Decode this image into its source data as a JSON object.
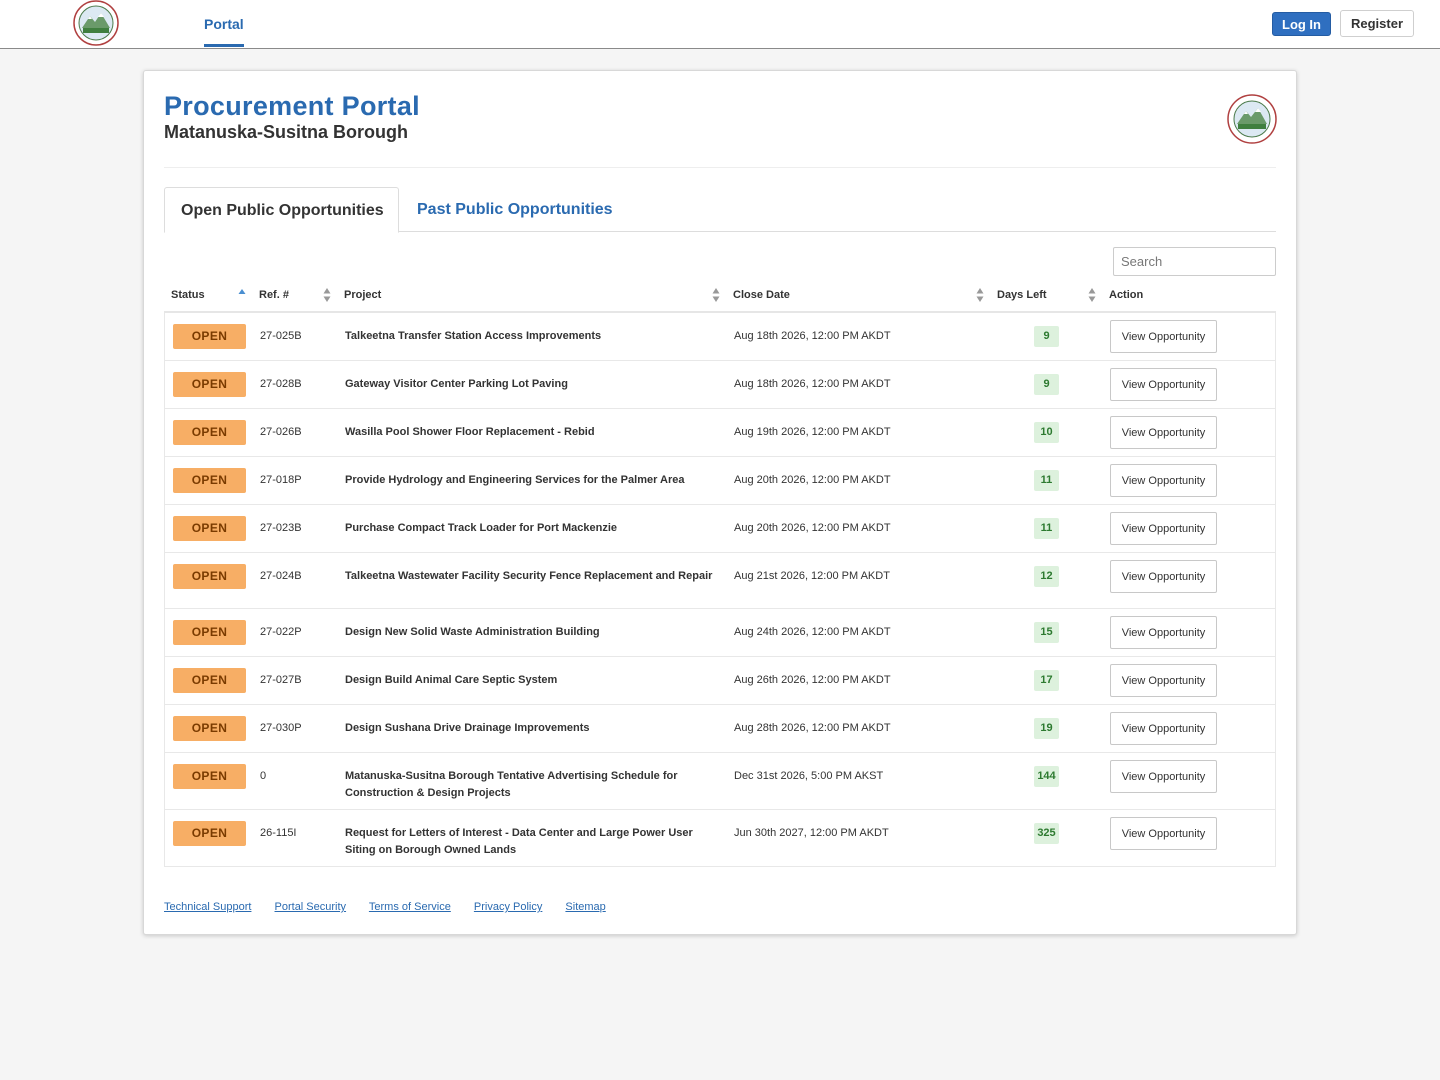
{
  "nav": {
    "portal_label": "Portal",
    "login_label": "Log In",
    "register_label": "Register"
  },
  "header": {
    "title": "Procurement Portal",
    "subtitle": "Matanuska-Susitna Borough"
  },
  "tabs": {
    "open": "Open Public Opportunities",
    "past": "Past Public Opportunities"
  },
  "search": {
    "placeholder": "Search",
    "value": ""
  },
  "table": {
    "columns": [
      "Status",
      "Ref. #",
      "Project",
      "Close Date",
      "Days Left",
      "Action"
    ],
    "rows": [
      {
        "status": "OPEN",
        "ref": "27-025B",
        "project": "Talkeetna Transfer Station Access Improvements",
        "close": "Aug 18th 2026, 12:00 PM AKDT",
        "days": "9",
        "action": "View Opportunity"
      },
      {
        "status": "OPEN",
        "ref": "27-028B",
        "project": "Gateway Visitor Center Parking Lot Paving",
        "close": "Aug 18th 2026, 12:00 PM AKDT",
        "days": "9",
        "action": "View Opportunity"
      },
      {
        "status": "OPEN",
        "ref": "27-026B",
        "project": "Wasilla Pool Shower Floor Replacement - Rebid",
        "close": "Aug 19th 2026, 12:00 PM AKDT",
        "days": "10",
        "action": "View Opportunity"
      },
      {
        "status": "OPEN",
        "ref": "27-018P",
        "project": "Provide Hydrology and Engineering Services for the Palmer Area",
        "close": "Aug 20th 2026, 12:00 PM AKDT",
        "days": "11",
        "action": "View Opportunity"
      },
      {
        "status": "OPEN",
        "ref": "27-023B",
        "project": "Purchase Compact Track Loader for Port Mackenzie",
        "close": "Aug 20th 2026, 12:00 PM AKDT",
        "days": "11",
        "action": "View Opportunity"
      },
      {
        "status": "OPEN",
        "ref": "27-024B",
        "project": "Talkeetna Wastewater Facility Security Fence Replacement and Repair",
        "close": "Aug 21st 2026, 12:00 PM AKDT",
        "days": "12",
        "action": "View Opportunity"
      },
      {
        "status": "OPEN",
        "ref": "27-022P",
        "project": "Design New Solid Waste Administration Building",
        "close": "Aug 24th 2026, 12:00 PM AKDT",
        "days": "15",
        "action": "View Opportunity"
      },
      {
        "status": "OPEN",
        "ref": "27-027B",
        "project": "Design Build Animal Care Septic System",
        "close": "Aug 26th 2026, 12:00 PM AKDT",
        "days": "17",
        "action": "View Opportunity"
      },
      {
        "status": "OPEN",
        "ref": "27-030P",
        "project": "Design Sushana Drive Drainage Improvements",
        "close": "Aug 28th 2026, 12:00 PM AKDT",
        "days": "19",
        "action": "View Opportunity"
      },
      {
        "status": "OPEN",
        "ref": "0",
        "project": "Matanuska-Susitna Borough Tentative Advertising Schedule for Construction & Design Projects",
        "close": "Dec 31st 2026, 5:00 PM AKST",
        "days": "144",
        "action": "View Opportunity"
      },
      {
        "status": "OPEN",
        "ref": "26-115I",
        "project": "Request for Letters of Interest - Data Center and Large Power User Siting on Borough Owned Lands",
        "close": "Jun 30th 2027, 12:00 PM AKDT",
        "days": "325",
        "action": "View Opportunity"
      }
    ]
  },
  "footer": [
    "Technical Support",
    "Portal Security",
    "Terms of Service",
    "Privacy Policy",
    "Sitemap"
  ],
  "colors": {
    "brand_blue": "#2a6ab0",
    "open_badge": "#f7ae65",
    "days_badge": "#ddf1dd"
  }
}
